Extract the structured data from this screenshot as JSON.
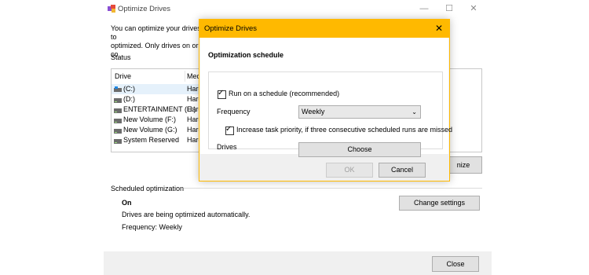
{
  "background_window": {
    "title": "Optimize Drives",
    "description_left": "You can optimize your drives to",
    "description_left_line2": "optimized. Only drives on or co",
    "description_right_fragment": "e",
    "status_label": "Status",
    "columns": {
      "drive": "Drive",
      "media": "Med"
    },
    "drives": [
      {
        "name": "(C:)",
        "media": "Hard",
        "icon": "system-drive-icon"
      },
      {
        "name": "(D:)",
        "media": "Hard",
        "icon": "hard-drive-icon"
      },
      {
        "name": "ENTERTAINMENT (E:)",
        "media": "Hard",
        "icon": "hard-drive-icon"
      },
      {
        "name": "New Volume (F:)",
        "media": "Hard",
        "icon": "hard-drive-icon"
      },
      {
        "name": "New Volume (G:)",
        "media": "Hard",
        "icon": "hard-drive-icon"
      },
      {
        "name": "System Reserved",
        "media": "Hard",
        "icon": "hard-drive-icon"
      }
    ],
    "optimize_partial_label": "nize",
    "scheduled_optimization_label": "Scheduled optimization",
    "schedule_state": "On",
    "schedule_description": "Drives are being optimized automatically.",
    "schedule_frequency": "Frequency: Weekly",
    "change_settings_label": "Change settings",
    "close_label": "Close",
    "window_controls": {
      "minimize": "—",
      "maximize": "☐",
      "close": "✕"
    }
  },
  "dialog": {
    "title": "Optimize Drives",
    "close_glyph": "✕",
    "heading": "Optimization schedule",
    "run_on_schedule_label": "Run on a schedule (recommended)",
    "run_on_schedule_checked": true,
    "frequency_label": "Frequency",
    "frequency_value": "Weekly",
    "increase_priority_label": "Increase task priority, if three consecutive scheduled runs are missed",
    "increase_priority_checked": true,
    "drives_label": "Drives",
    "choose_label": "Choose",
    "ok_label": "OK",
    "cancel_label": "Cancel",
    "check_glyph": "✓",
    "chevron_glyph": "⌄"
  },
  "colors": {
    "dialog_accent": "#ffb900",
    "selected_row": "#e5f1fb"
  }
}
